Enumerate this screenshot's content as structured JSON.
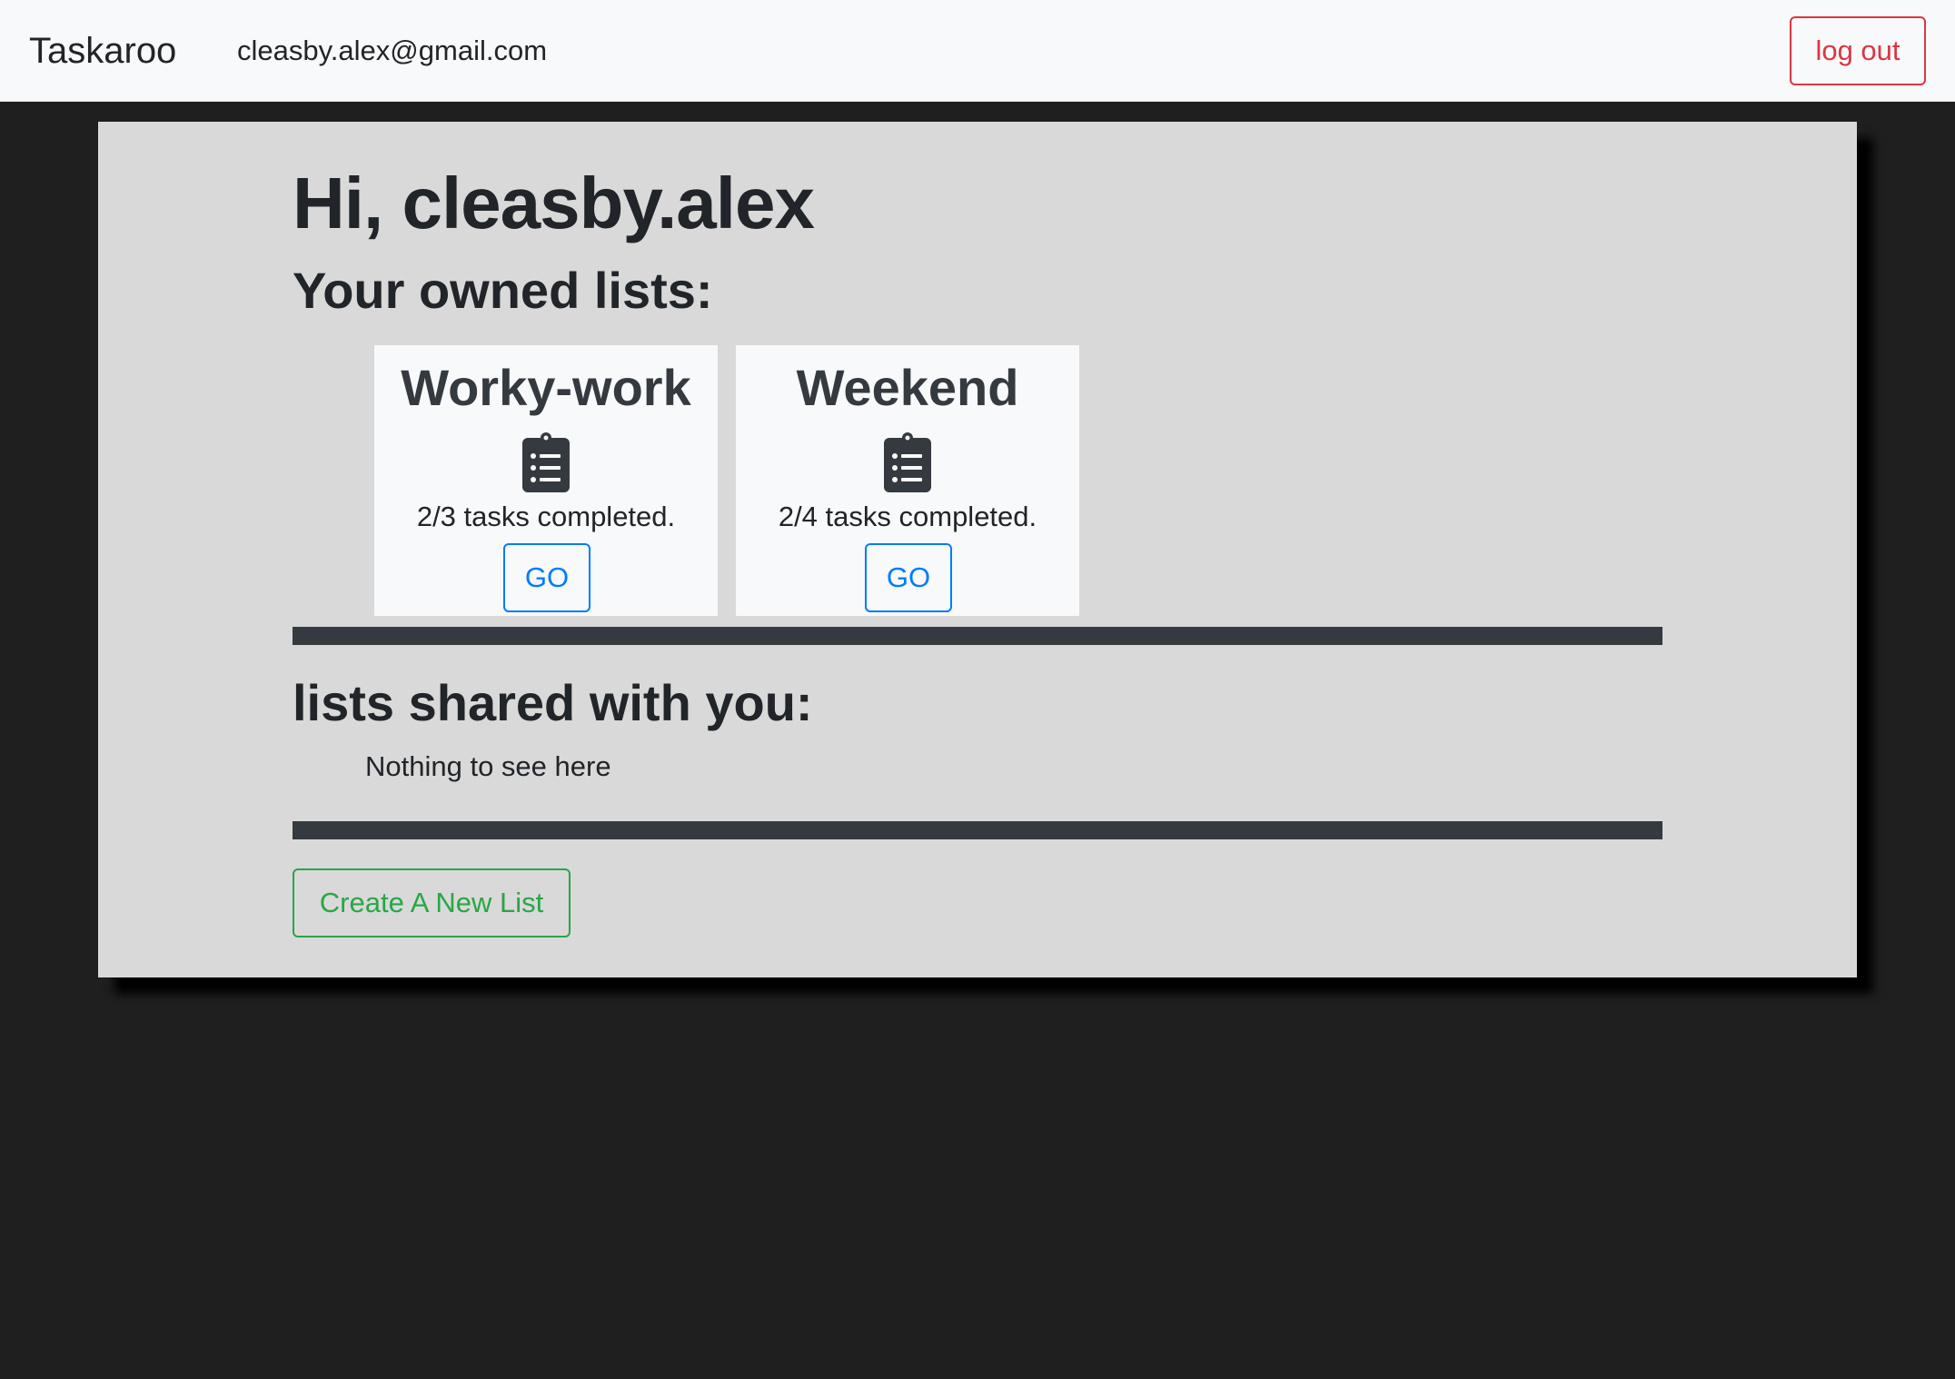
{
  "navbar": {
    "brand": "Taskaroo",
    "user_email": "cleasby.alex@gmail.com",
    "logout_label": "log out"
  },
  "main": {
    "greeting": "Hi, cleasby.alex",
    "owned_heading": "Your owned lists:",
    "owned_lists": [
      {
        "title": "Worky-work",
        "icon": "clipboard-list-icon",
        "progress_text": "2/3 tasks completed.",
        "completed": 2,
        "total": 3,
        "go_label": "GO"
      },
      {
        "title": "Weekend",
        "icon": "clipboard-list-icon",
        "progress_text": "2/4 tasks completed.",
        "completed": 2,
        "total": 4,
        "go_label": "GO"
      }
    ],
    "shared_heading": "lists shared with you:",
    "shared_empty_text": "Nothing to see here",
    "create_label": "Create A New List"
  },
  "colors": {
    "page_background": "#1f1f1f",
    "navbar_background": "#f8f9fa",
    "panel_background": "#d9d9d9",
    "card_background": "#f8f9fa",
    "divider": "#343a40",
    "danger": "#dc3545",
    "primary": "#007bff",
    "success": "#28a745"
  }
}
